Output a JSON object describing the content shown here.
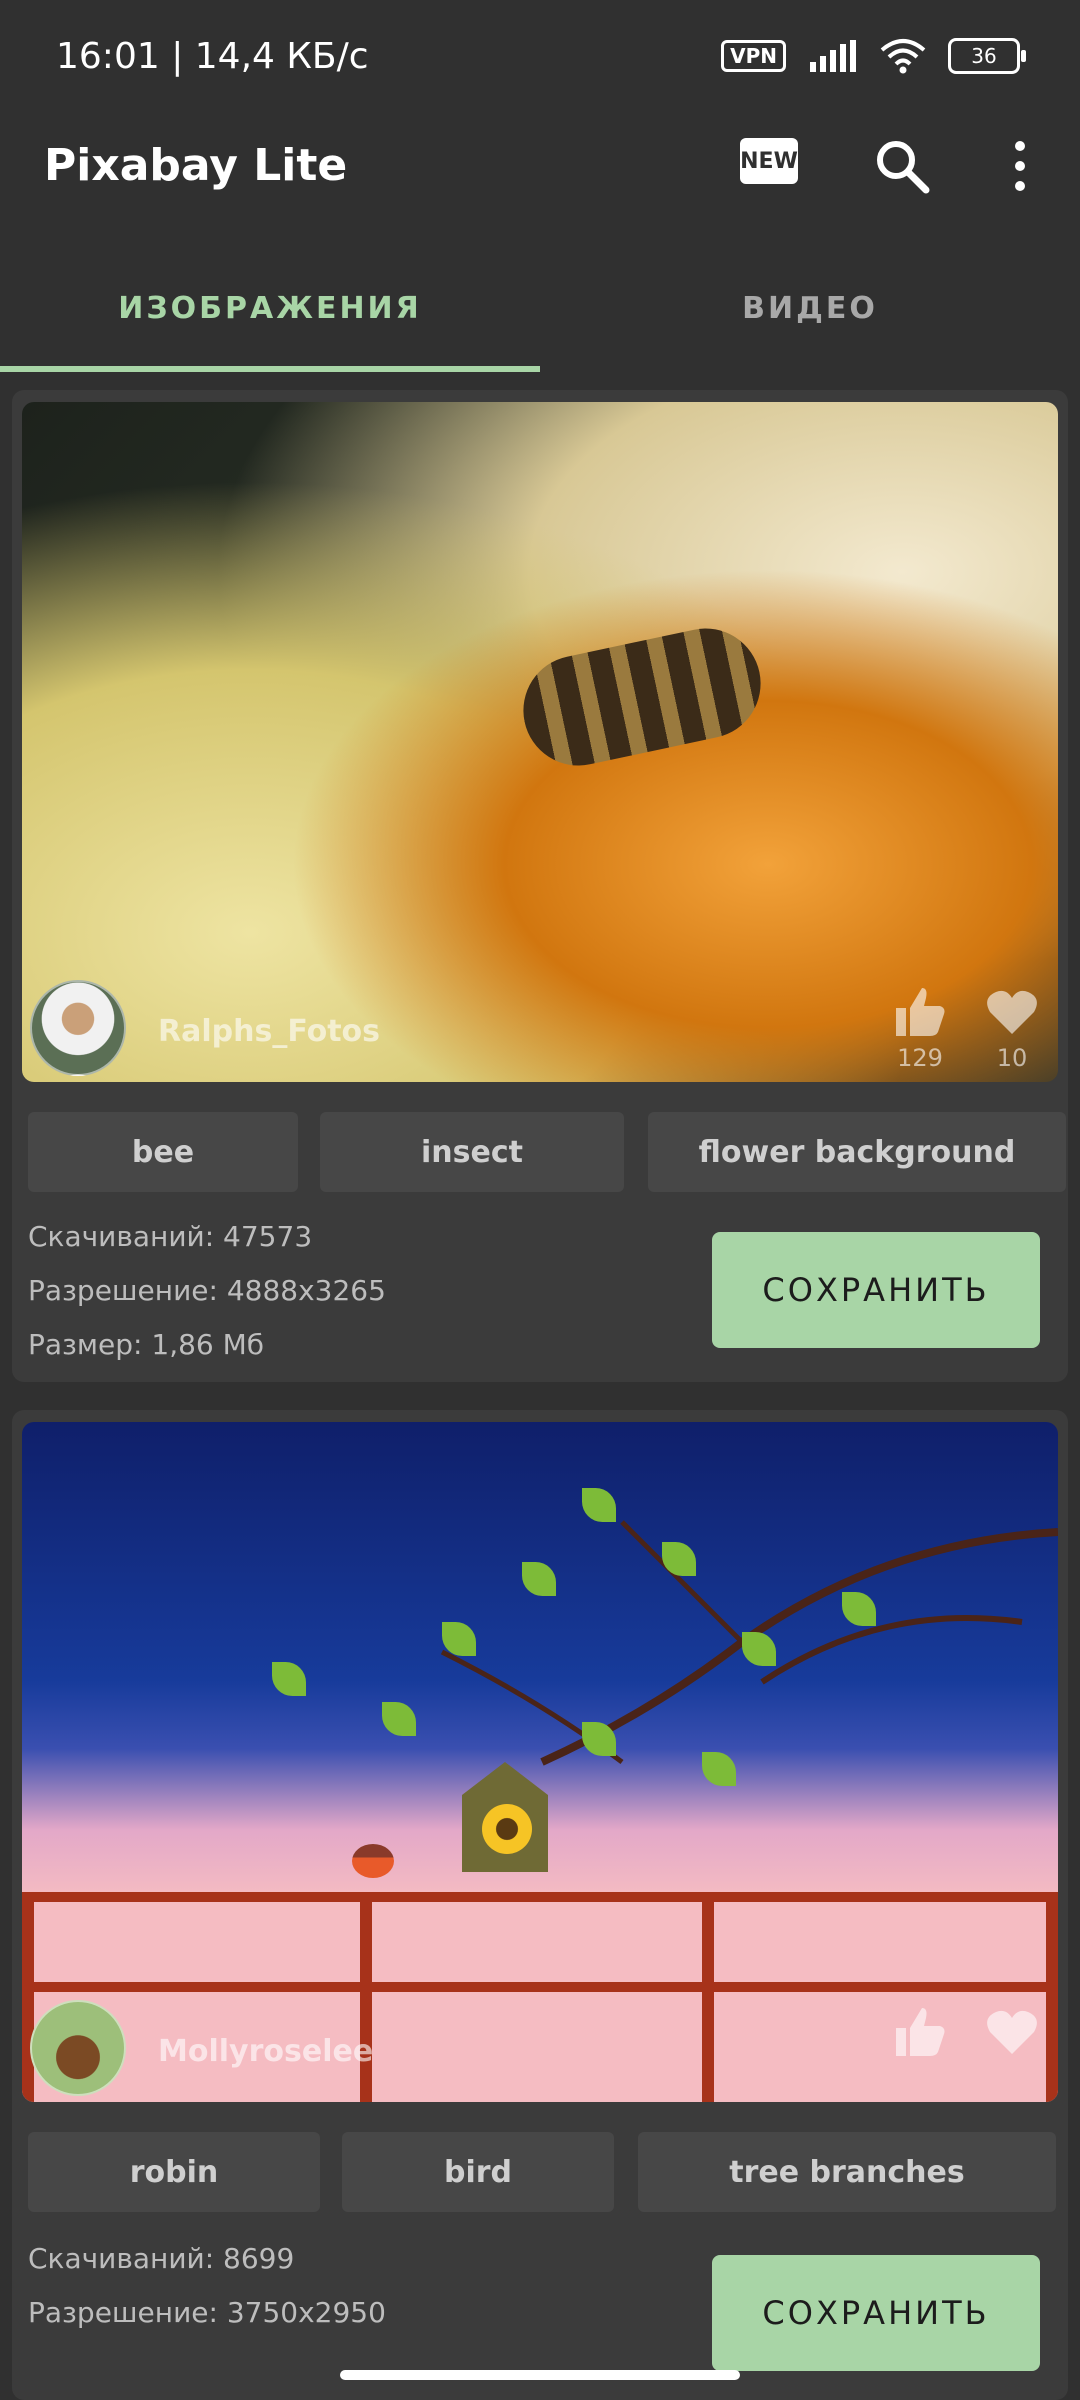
{
  "status_bar": {
    "time_speed": "16:01 | 14,4 КБ/с",
    "vpn": "VPN",
    "battery": "36"
  },
  "app_bar": {
    "title": "Pixabay Lite",
    "new_label": "NEW"
  },
  "tabs": [
    {
      "label": "ИЗОБРАЖЕНИЯ",
      "active": true
    },
    {
      "label": "ВИДЕО",
      "active": false
    }
  ],
  "cards": [
    {
      "user": "Ralphs_Fotos",
      "likes": "129",
      "favorites": "10",
      "tags": [
        "bee",
        "insect",
        "flower background"
      ],
      "downloads": "Скачиваний: 47573",
      "resolution": "Разрешение: 4888x3265",
      "size": "Размер: 1,86 Мб",
      "save_label": "СОХРАНИТЬ"
    },
    {
      "user": "Mollyroselee",
      "likes": "",
      "favorites": "",
      "tags": [
        "robin",
        "bird",
        "tree branches"
      ],
      "downloads": "Скачиваний: 8699",
      "resolution": "Разрешение: 3750x2950",
      "save_label": "СОХРАНИТЬ"
    }
  ],
  "colors": {
    "accent": "#a8d5a6",
    "background": "#303030",
    "card": "#3b3b3b"
  }
}
